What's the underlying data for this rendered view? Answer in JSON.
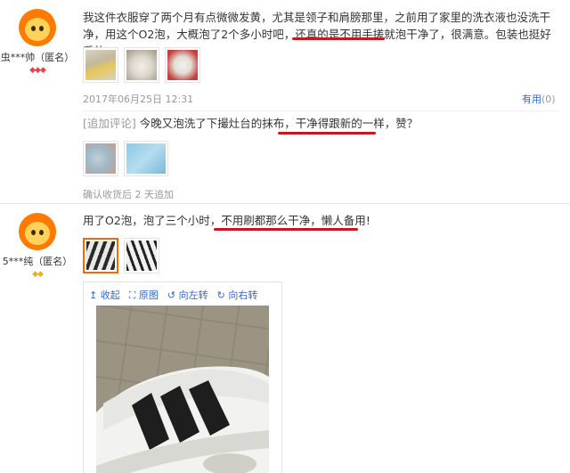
{
  "review1": {
    "username": "虫***帅（匿名）",
    "rank_icons": "◆◆◆",
    "text_part1": "我这件衣服穿了两个月有点微微发黄，尤其是领子和肩膀那里，之前用了家里的洗衣液也没洗干净，用这个O2泡，大概泡了2个多小时吧，还真的是",
    "text_highlight": "不用手搓就泡干净了",
    "text_part2": "，很满意。包装也挺好看的。",
    "date": "2017年06月25日 12:31",
    "useful_label": "有用",
    "useful_count": "(0)",
    "append": {
      "label": "[追加评论]",
      "text_part1": "今晚又泡洗了下撮灶台的抹布，",
      "text_highlight": "干净得跟新的一样",
      "text_part2": "，赞？",
      "meta": "确认收货后 2 天追加"
    }
  },
  "review2": {
    "username": "5***纯（匿名）",
    "rank_icons": "◆◆",
    "text_part1": "用了O2泡，泡了三个小时，",
    "text_highlight": "不用刷都那么干净，懒人备用",
    "text_part2": "!",
    "viewer": {
      "collapse": "收起",
      "original": "原图",
      "rotate_left": "向左转",
      "rotate_right": "向右转"
    }
  },
  "colors": {
    "highlight_underline": "#c8171e",
    "link_blue": "#3366cc",
    "avatar_orange": "#ff7a00"
  }
}
